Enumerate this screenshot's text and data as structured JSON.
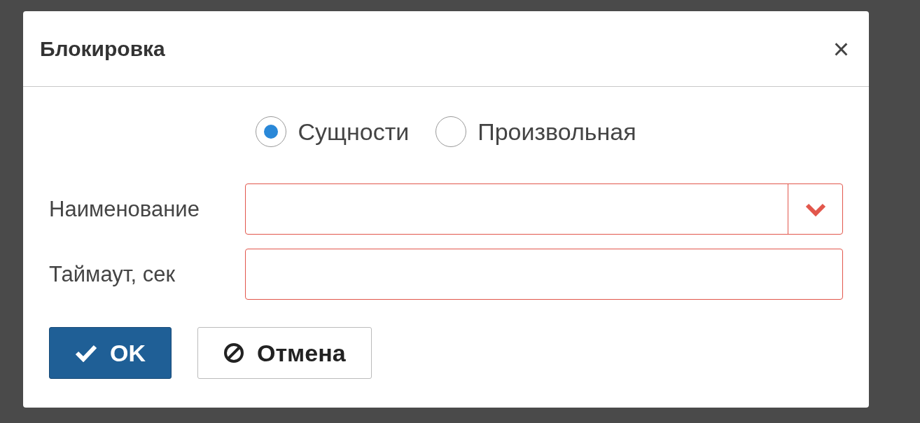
{
  "dialog": {
    "title": "Блокировка",
    "close": "×"
  },
  "radios": [
    {
      "label": "Сущности",
      "selected": true
    },
    {
      "label": "Произвольная",
      "selected": false
    }
  ],
  "fields": [
    {
      "label": "Наименование",
      "kind": "select",
      "invalid": true
    },
    {
      "label": "Таймаут, сек",
      "kind": "text",
      "invalid": true
    }
  ],
  "buttons": [
    {
      "label": "OK",
      "kind": "primary"
    },
    {
      "label": "Отмена",
      "kind": "cancel"
    }
  ]
}
